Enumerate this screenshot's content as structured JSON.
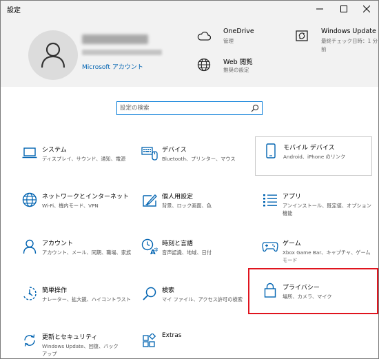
{
  "window": {
    "title": "設定"
  },
  "account": {
    "name_blurred": "個人2000番",
    "email_blurred": "sample@fmvfhbcuhm.jp",
    "link_label": "Microsoft アカウント"
  },
  "header_items": [
    {
      "title": "OneDrive",
      "subtitle": "管理",
      "icon": "cloud-icon"
    },
    {
      "title": "Web 閲覧",
      "subtitle": "推奨の設定",
      "icon": "globe-icon"
    },
    {
      "title": "Windows Update",
      "subtitle_line1": "最終チェック日時：1 分",
      "subtitle_line2": "前",
      "icon": "sync-icon"
    }
  ],
  "search": {
    "placeholder": "設定の検索"
  },
  "tiles": [
    {
      "title": "システム",
      "subtitle": "ディスプレイ、サウンド、通知、電源",
      "icon": "laptop-icon"
    },
    {
      "title": "デバイス",
      "subtitle": "Bluetooth、プリンター、マウス",
      "icon": "keyboard-icon"
    },
    {
      "title": "モバイル デバイス",
      "subtitle": "Android、iPhone のリンク",
      "icon": "phone-icon"
    },
    {
      "title": "ネットワークとインターネット",
      "subtitle": "Wi-Fi、機内モード、VPN",
      "icon": "globe-icon"
    },
    {
      "title": "個人用設定",
      "subtitle": "背景、ロック画面、色",
      "icon": "paint-icon"
    },
    {
      "title": "アプリ",
      "subtitle": "アンインストール、既定値、オプション機能",
      "icon": "apps-list-icon"
    },
    {
      "title": "アカウント",
      "subtitle": "アカウント、メール、同期、職場、家族",
      "icon": "person-icon"
    },
    {
      "title": "時刻と言語",
      "subtitle": "音声認識、地域、日付",
      "icon": "time-language-icon"
    },
    {
      "title": "ゲーム",
      "subtitle": "Xbox Game Bar、キャプチャ、ゲーム モード",
      "icon": "gamepad-icon"
    },
    {
      "title": "簡単操作",
      "subtitle": "ナレーター、拡大鏡、ハイコントラスト",
      "icon": "ease-of-access-icon"
    },
    {
      "title": "検索",
      "subtitle": "マイ ファイル、アクセス許可の検索",
      "icon": "search-icon"
    },
    {
      "title": "プライバシー",
      "subtitle": "場所、カメラ、マイク",
      "icon": "lock-icon"
    },
    {
      "title": "更新とセキュリティ",
      "subtitle": "Windows Update、回復、バックアップ",
      "icon": "update-icon"
    },
    {
      "title": "Extras",
      "subtitle": "",
      "icon": "extras-icon"
    }
  ],
  "colors": {
    "accent": "#0078d7",
    "link": "#0063b1",
    "header_bg": "#f2f2f2",
    "highlight": "#e0141e"
  }
}
